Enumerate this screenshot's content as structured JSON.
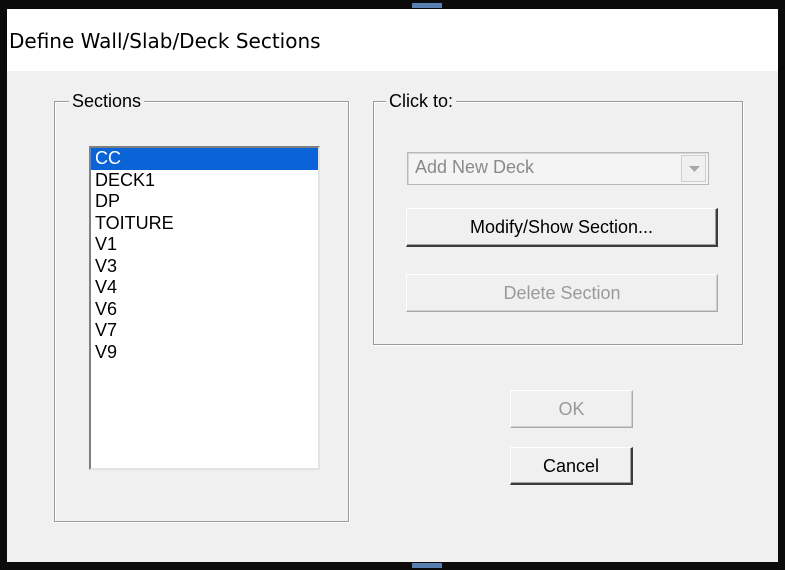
{
  "window": {
    "title": "Define Wall/Slab/Deck Sections"
  },
  "sections_group": {
    "legend": "Sections",
    "items": [
      "CC",
      "DECK1",
      "DP",
      "TOITURE",
      "V1",
      "V3",
      "V4",
      "V6",
      "V7",
      "V9"
    ],
    "selected_index": 0
  },
  "click_to_group": {
    "legend": "Click to:",
    "add_combo": {
      "value": "Add New Deck",
      "enabled": false
    },
    "modify_button_label": "Modify/Show Section...",
    "delete_button_label": "Delete Section",
    "delete_button_enabled": false
  },
  "footer": {
    "ok_label": "OK",
    "ok_enabled": false,
    "cancel_label": "Cancel"
  },
  "colors": {
    "selection": "#0a64d8",
    "dialog_background": "#f0f0f0",
    "disabled_text": "#9a9a9a"
  },
  "icons": {
    "combo_arrow": "chevron-down-icon"
  }
}
